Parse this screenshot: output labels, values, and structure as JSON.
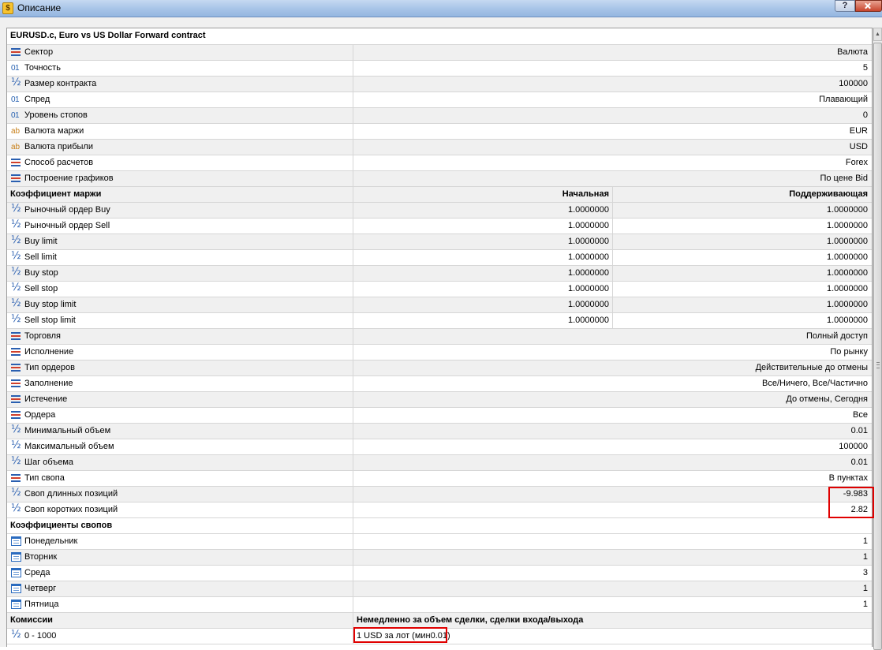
{
  "window": {
    "title": "Описание",
    "help_label": "?"
  },
  "symbol_title": "EURUSD.c, Euro vs US Dollar Forward contract",
  "general": [
    {
      "icon": "enum-icon",
      "label": "Сектор",
      "value": "Валюта"
    },
    {
      "icon": "integer-icon",
      "label": "Точность",
      "value": "5"
    },
    {
      "icon": "fraction-icon",
      "label": "Размер контракта",
      "value": "100000"
    },
    {
      "icon": "integer-icon",
      "label": "Спред",
      "value": "Плавающий"
    },
    {
      "icon": "integer-icon",
      "label": "Уровень стопов",
      "value": "0"
    },
    {
      "icon": "string-icon",
      "label": "Валюта маржи",
      "value": "EUR"
    },
    {
      "icon": "string-icon",
      "label": "Валюта прибыли",
      "value": "USD"
    },
    {
      "icon": "enum-icon",
      "label": "Способ расчетов",
      "value": "Forex"
    },
    {
      "icon": "enum-icon",
      "label": "Построение графиков",
      "value": "По цене Bid"
    }
  ],
  "margin": {
    "header": "Коэффициент маржи",
    "col_initial": "Начальная",
    "col_maintenance": "Поддерживающая",
    "rows": [
      {
        "label": "Рыночный ордер Buy",
        "initial": "1.0000000",
        "maintenance": "1.0000000"
      },
      {
        "label": "Рыночный ордер Sell",
        "initial": "1.0000000",
        "maintenance": "1.0000000"
      },
      {
        "label": "Buy limit",
        "initial": "1.0000000",
        "maintenance": "1.0000000"
      },
      {
        "label": "Sell limit",
        "initial": "1.0000000",
        "maintenance": "1.0000000"
      },
      {
        "label": "Buy stop",
        "initial": "1.0000000",
        "maintenance": "1.0000000"
      },
      {
        "label": "Sell stop",
        "initial": "1.0000000",
        "maintenance": "1.0000000"
      },
      {
        "label": "Buy stop limit",
        "initial": "1.0000000",
        "maintenance": "1.0000000"
      },
      {
        "label": "Sell stop limit",
        "initial": "1.0000000",
        "maintenance": "1.0000000"
      }
    ]
  },
  "trading": [
    {
      "icon": "enum-icon",
      "label": "Торговля",
      "value": "Полный доступ"
    },
    {
      "icon": "enum-icon",
      "label": "Исполнение",
      "value": "По рынку"
    },
    {
      "icon": "enum-icon",
      "label": "Тип ордеров",
      "value": "Действительные до отмены"
    },
    {
      "icon": "enum-icon",
      "label": "Заполнение",
      "value": "Все/Ничего, Все/Частично"
    },
    {
      "icon": "enum-icon",
      "label": "Истечение",
      "value": "До отмены, Сегодня"
    },
    {
      "icon": "enum-icon",
      "label": "Ордера",
      "value": "Все"
    },
    {
      "icon": "fraction-icon",
      "label": "Минимальный объем",
      "value": "0.01"
    },
    {
      "icon": "fraction-icon",
      "label": "Максимальный объем",
      "value": "100000"
    },
    {
      "icon": "fraction-icon",
      "label": "Шаг объема",
      "value": "0.01"
    },
    {
      "icon": "enum-icon",
      "label": "Тип свопа",
      "value": "В пунктах"
    },
    {
      "icon": "fraction-icon",
      "label": "Своп длинных позиций",
      "value": "-9.983"
    },
    {
      "icon": "fraction-icon",
      "label": "Своп коротких позиций",
      "value": "2.82"
    }
  ],
  "swaps": {
    "header": "Коэффициенты свопов",
    "days": [
      {
        "label": "Понедельник",
        "value": "1"
      },
      {
        "label": "Вторник",
        "value": "1"
      },
      {
        "label": "Среда",
        "value": "3"
      },
      {
        "label": "Четверг",
        "value": "1"
      },
      {
        "label": "Пятница",
        "value": "1"
      }
    ]
  },
  "commission": {
    "header": "Комиссии",
    "header_value": "Немедленно за объем сделки, сделки входа/выхода",
    "rows": [
      {
        "label": "0 - 1000",
        "value": "1 USD за лот (мин0.01)"
      }
    ]
  },
  "colors": {
    "highlight": "#e00000",
    "row_alt": "#f0f0f0"
  }
}
